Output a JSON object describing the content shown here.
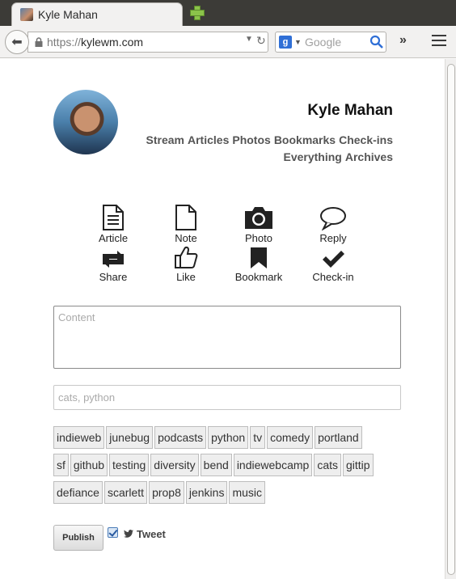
{
  "browser": {
    "tab_title": "Kyle Mahan",
    "url_scheme": "https://",
    "url_host": "kylewm.com",
    "search_placeholder": "Google"
  },
  "site": {
    "name": "Kyle Mahan",
    "nav": [
      "Stream",
      "Articles",
      "Photos",
      "Bookmarks",
      "Check-ins",
      "Everything",
      "Archives"
    ]
  },
  "post_types": [
    {
      "label": "Article",
      "icon": "article-icon"
    },
    {
      "label": "Note",
      "icon": "note-icon"
    },
    {
      "label": "Photo",
      "icon": "camera-icon"
    },
    {
      "label": "Reply",
      "icon": "speech-bubble-icon"
    },
    {
      "label": "Share",
      "icon": "retweet-icon"
    },
    {
      "label": "Like",
      "icon": "thumbs-up-icon"
    },
    {
      "label": "Bookmark",
      "icon": "bookmark-icon"
    },
    {
      "label": "Check-in",
      "icon": "checkmark-icon"
    }
  ],
  "editor": {
    "content_placeholder": "Content",
    "tags_placeholder": "cats, python"
  },
  "tags": [
    [
      "indieweb",
      "junebug",
      "podcasts",
      "python",
      "tv",
      "comedy",
      "portland"
    ],
    [
      "sf",
      "github",
      "testing",
      "diversity",
      "bend",
      "indiewebcamp",
      "cats",
      "gittip"
    ],
    [
      "defiance",
      "scarlett",
      "prop8",
      "jenkins",
      "music"
    ]
  ],
  "actions": {
    "publish_label": "Publish",
    "tweet_label": "Tweet",
    "tweet_checked": true
  }
}
